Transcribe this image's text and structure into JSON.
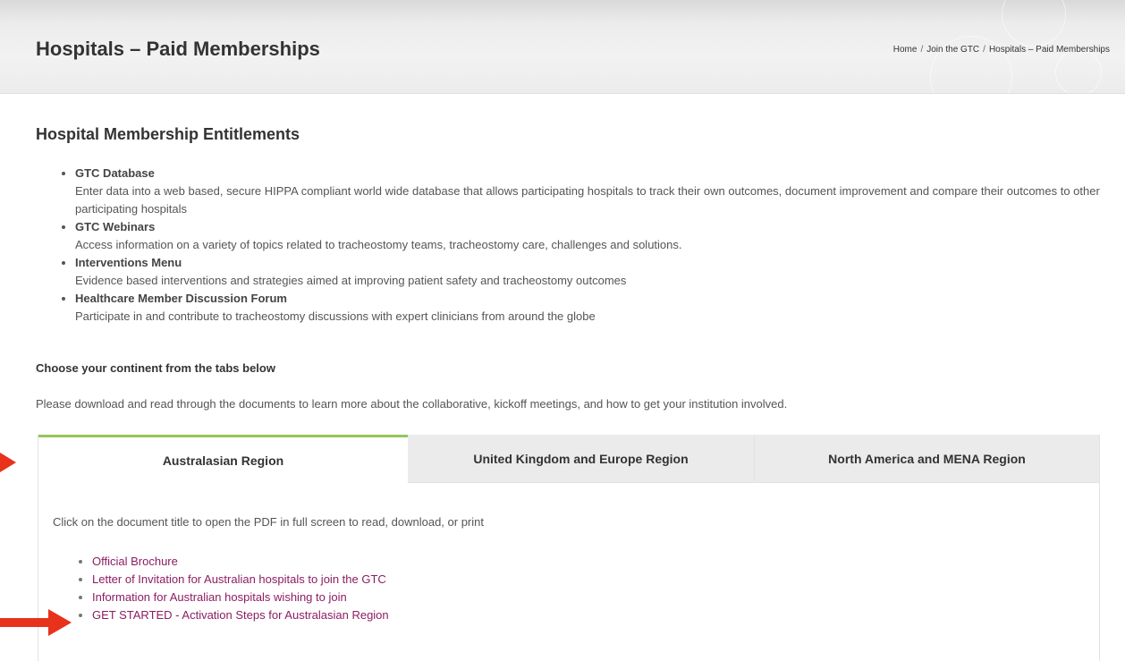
{
  "header": {
    "title": "Hospitals – Paid Memberships",
    "breadcrumb": [
      "Home",
      "Join the GTC",
      "Hospitals – Paid Memberships"
    ],
    "breadcrumb_separator": "/"
  },
  "entitlements": {
    "heading": "Hospital Membership Entitlements",
    "items": [
      {
        "title": "GTC Database",
        "description": "Enter data into a web based, secure HIPPA compliant world wide database that allows participating hospitals to track their own outcomes, document improvement and compare their outcomes to other participating hospitals"
      },
      {
        "title": "GTC Webinars",
        "description": "Access information on a variety of topics related to tracheostomy teams, tracheostomy care, challenges and solutions."
      },
      {
        "title": "Interventions Menu",
        "description": "Evidence based interventions and strategies aimed at improving patient safety and tracheostomy outcomes"
      },
      {
        "title": "Healthcare Member Discussion Forum",
        "description": "Participate in and contribute to tracheostomy discussions with expert clinicians from around the globe"
      }
    ]
  },
  "choose": {
    "heading": "Choose your continent from the tabs below",
    "intro": "Please download and read through the documents to learn more about the collaborative, kickoff meetings, and how to get your institution involved."
  },
  "tabs": [
    {
      "label": "Australasian Region",
      "active": true
    },
    {
      "label": "United Kingdom and Europe Region",
      "active": false
    },
    {
      "label": "North America and MENA Region",
      "active": false
    }
  ],
  "tab_content": {
    "intro": "Click on the document title to open the PDF in full screen to read, download, or print",
    "documents": [
      "Official Brochure",
      "Letter of Invitation for Australian hospitals to join the GTC",
      "Information for Australian hospitals wishing to join",
      "GET STARTED - Activation Steps for Australasian Region"
    ]
  },
  "colors": {
    "link": "#8c1d63",
    "active_tab_accent": "#92c65a",
    "annotation_arrow": "#e8321c"
  }
}
